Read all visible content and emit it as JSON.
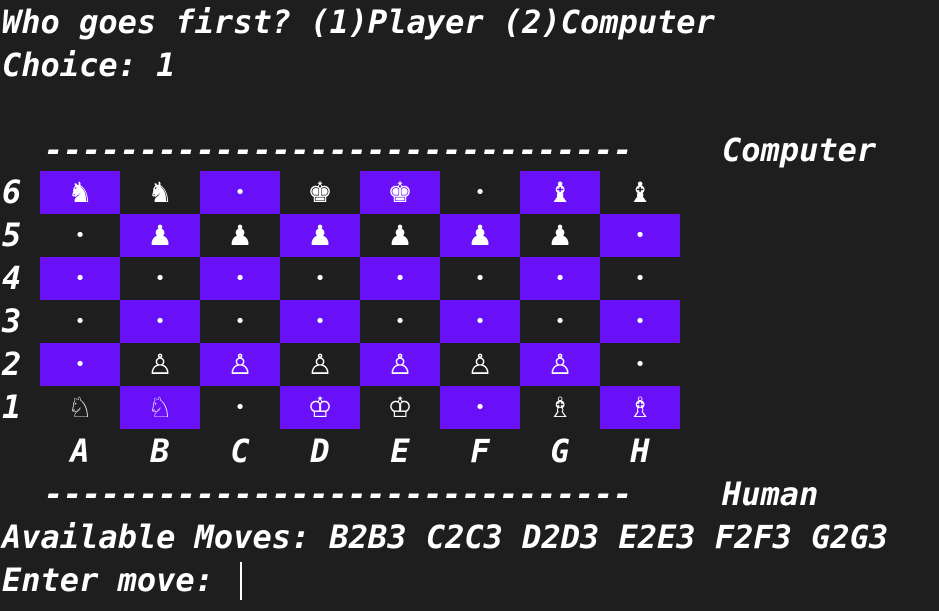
{
  "terminal": {
    "prompt": "Who goes first? (1)Player (2)Computer",
    "choice": "Choice: 1",
    "divider": "-------------------------------",
    "top_label": "Computer",
    "bottom_label": "Human",
    "available_moves": "Available Moves: B2B3 C2C3 D2D3 E2E3 F2F3 G2G3",
    "enter_move": "Enter move: "
  },
  "board": {
    "files": [
      "A",
      "B",
      "C",
      "D",
      "E",
      "F",
      "G",
      "H"
    ],
    "ranks": [
      "6",
      "5",
      "4",
      "3",
      "2",
      "1"
    ],
    "light_color": "#6a10f8",
    "rows": [
      [
        "♞",
        "♞",
        "•",
        "♚",
        "♚",
        "•",
        "♝",
        "♝"
      ],
      [
        "•",
        "♟",
        "♟",
        "♟",
        "♟",
        "♟",
        "♟",
        "•"
      ],
      [
        "•",
        "•",
        "•",
        "•",
        "•",
        "•",
        "•",
        "•"
      ],
      [
        "•",
        "•",
        "•",
        "•",
        "•",
        "•",
        "•",
        "•"
      ],
      [
        "•",
        "♙",
        "♙",
        "♙",
        "♙",
        "♙",
        "♙",
        "•"
      ],
      [
        "♘",
        "♘",
        "•",
        "♔",
        "♔",
        "•",
        "♗",
        "♗"
      ]
    ],
    "piece_names": [
      [
        "knight",
        "knight",
        "empty",
        "king",
        "king",
        "empty",
        "bishop",
        "bishop"
      ],
      [
        "empty",
        "pawn",
        "pawn",
        "pawn",
        "pawn",
        "pawn",
        "pawn",
        "empty"
      ],
      [
        "empty",
        "empty",
        "empty",
        "empty",
        "empty",
        "empty",
        "empty",
        "empty"
      ],
      [
        "empty",
        "empty",
        "empty",
        "empty",
        "empty",
        "empty",
        "empty",
        "empty"
      ],
      [
        "empty",
        "pawn",
        "pawn",
        "pawn",
        "pawn",
        "pawn",
        "pawn",
        "empty"
      ],
      [
        "knight",
        "knight",
        "empty",
        "king",
        "king",
        "empty",
        "bishop",
        "bishop"
      ]
    ]
  }
}
